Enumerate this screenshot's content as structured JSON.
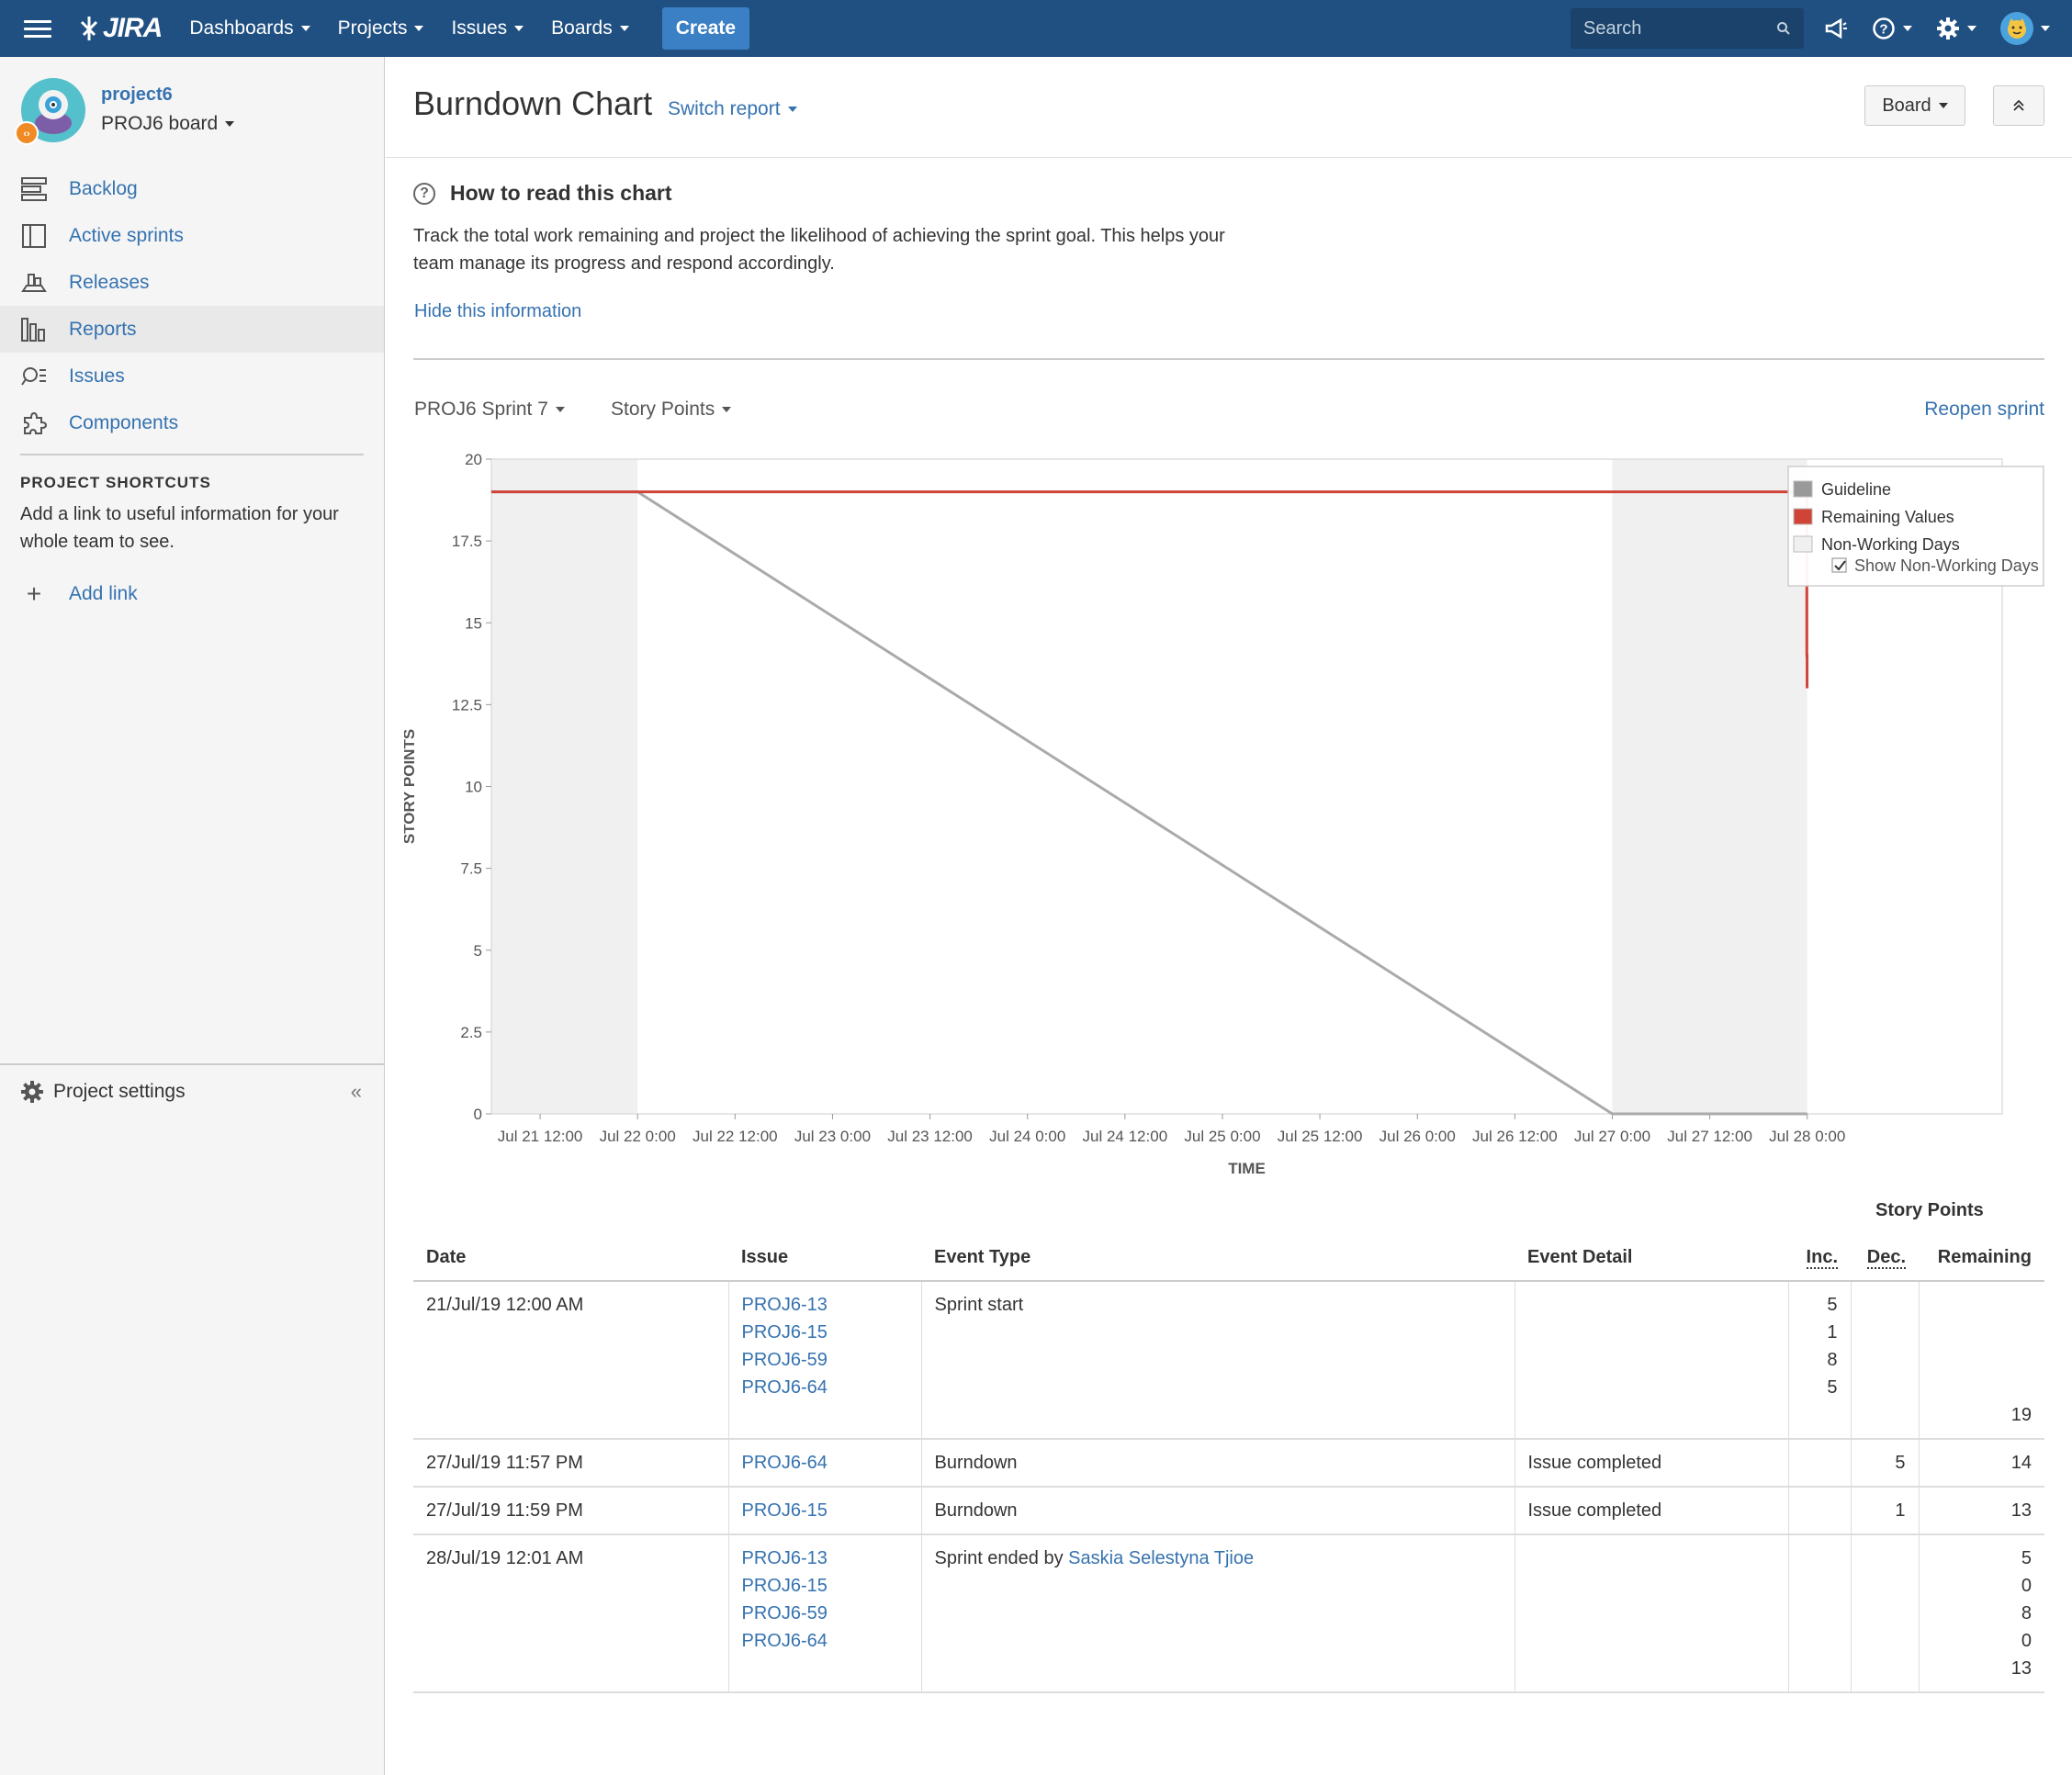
{
  "topbar": {
    "logo": "JIRA",
    "nav": [
      {
        "label": "Dashboards"
      },
      {
        "label": "Projects"
      },
      {
        "label": "Issues"
      },
      {
        "label": "Boards"
      }
    ],
    "create_label": "Create",
    "search_placeholder": "Search"
  },
  "sidebar": {
    "project_name": "project6",
    "board_name": "PROJ6 board",
    "items": [
      {
        "label": "Backlog",
        "icon": "backlog-icon"
      },
      {
        "label": "Active sprints",
        "icon": "active-sprints-icon"
      },
      {
        "label": "Releases",
        "icon": "releases-icon"
      },
      {
        "label": "Reports",
        "icon": "reports-icon",
        "active": true
      },
      {
        "label": "Issues",
        "icon": "issues-icon"
      },
      {
        "label": "Components",
        "icon": "components-icon"
      }
    ],
    "shortcuts_title": "PROJECT SHORTCUTS",
    "shortcuts_desc": "Add a link to useful information for your whole team to see.",
    "add_link": "Add link",
    "project_settings": "Project settings"
  },
  "main": {
    "title": "Burndown Chart",
    "switch_report": "Switch report",
    "board_button": "Board",
    "info_title": "How to read this chart",
    "info_text": "Track the total work remaining and project the likelihood of achieving the sprint goal. This helps your team manage its progress and respond accordingly.",
    "hide_info": "Hide this information",
    "sprint_select": "PROJ6 Sprint 7",
    "estimate_select": "Story Points",
    "reopen_sprint": "Reopen sprint"
  },
  "chart_data": {
    "type": "line",
    "xlabel": "TIME",
    "ylabel": "STORY POINTS",
    "ylim": [
      0,
      20
    ],
    "yticks": [
      "0",
      "2.5",
      "5",
      "7.5",
      "10",
      "12.5",
      "15",
      "17.5",
      "20"
    ],
    "xticks": [
      "Jul 21 12:00",
      "Jul 22 0:00",
      "Jul 22 12:00",
      "Jul 23 0:00",
      "Jul 23 12:00",
      "Jul 24 0:00",
      "Jul 24 12:00",
      "Jul 25 0:00",
      "Jul 25 12:00",
      "Jul 26 0:00",
      "Jul 26 12:00",
      "Jul 27 0:00",
      "Jul 27 12:00",
      "Jul 28 0:00"
    ],
    "x_range_hours": [
      -18,
      168
    ],
    "non_working_ranges_hours": [
      [
        -18,
        0
      ],
      [
        120,
        144
      ]
    ],
    "series": [
      {
        "name": "Guideline",
        "color": "#aaaaaa",
        "points": [
          [
            -18,
            19
          ],
          [
            0,
            19
          ],
          [
            120,
            0
          ],
          [
            144,
            0
          ]
        ]
      },
      {
        "name": "Remaining Values",
        "color": "#d04437",
        "points": [
          [
            -18,
            19
          ],
          [
            143.95,
            19
          ],
          [
            143.95,
            14
          ],
          [
            143.98,
            14
          ],
          [
            143.98,
            13
          ]
        ]
      }
    ],
    "legend": {
      "position": "top-right",
      "items": [
        {
          "label": "Guideline",
          "color": "#999999"
        },
        {
          "label": "Remaining Values",
          "color": "#d04437"
        },
        {
          "label": "Non-Working Days",
          "color": "#f0f0f0"
        }
      ],
      "checkbox_label": "Show Non-Working Days",
      "checked": true
    }
  },
  "table": {
    "story_points_header": "Story Points",
    "headers": {
      "date": "Date",
      "issue": "Issue",
      "event_type": "Event Type",
      "event_detail": "Event Detail",
      "inc": "Inc.",
      "dec": "Dec.",
      "remaining": "Remaining"
    },
    "rows": [
      {
        "date": "21/Jul/19 12:00 AM",
        "issues": [
          "PROJ6-13",
          "PROJ6-15",
          "PROJ6-59",
          "PROJ6-64"
        ],
        "event_type": "Sprint start",
        "event_link": "",
        "event_detail": "",
        "inc": [
          "5",
          "1",
          "8",
          "5"
        ],
        "dec": [],
        "remaining": [
          "",
          "",
          "",
          "",
          "19"
        ]
      },
      {
        "date": "27/Jul/19 11:57 PM",
        "issues": [
          "PROJ6-64"
        ],
        "event_type": "Burndown",
        "event_link": "",
        "event_detail": "Issue completed",
        "inc": [],
        "dec": [
          "5"
        ],
        "remaining": [
          "14"
        ]
      },
      {
        "date": "27/Jul/19 11:59 PM",
        "issues": [
          "PROJ6-15"
        ],
        "event_type": "Burndown",
        "event_link": "",
        "event_detail": "Issue completed",
        "inc": [],
        "dec": [
          "1"
        ],
        "remaining": [
          "13"
        ]
      },
      {
        "date": "28/Jul/19 12:01 AM",
        "issues": [
          "PROJ6-13",
          "PROJ6-15",
          "PROJ6-59",
          "PROJ6-64"
        ],
        "event_type": "Sprint ended by ",
        "event_link": "Saskia Selestyna Tjioe",
        "event_detail": "",
        "inc": [],
        "dec": [],
        "remaining": [
          "5",
          "0",
          "8",
          "0",
          "13"
        ]
      }
    ]
  }
}
